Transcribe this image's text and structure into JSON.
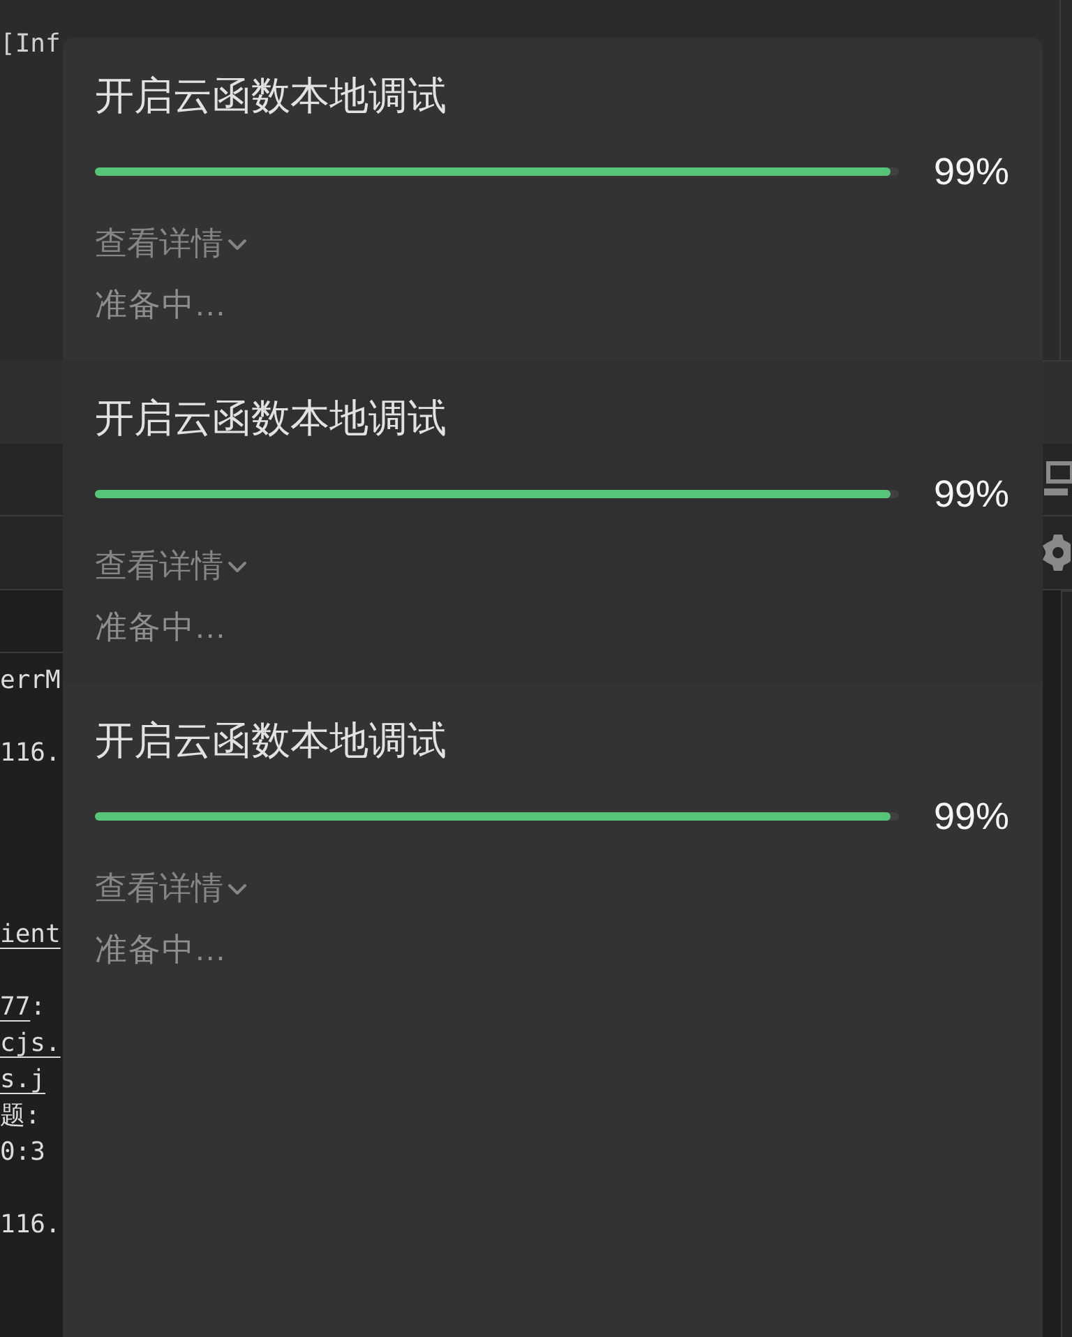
{
  "editor": {
    "code_line": "[Inf"
  },
  "console": {
    "lines": [
      {
        "segments": [
          {
            "text": "errM",
            "link": false
          }
        ]
      },
      {
        "segments": [
          {
            "text": "116.",
            "link": false
          }
        ]
      },
      {
        "segments": [
          {
            "text": "ient",
            "link": true
          }
        ]
      },
      {
        "segments": [
          {
            "text": "77",
            "link": true
          },
          {
            "text": ":",
            "link": false
          }
        ]
      },
      {
        "segments": [
          {
            "text": "cjs.",
            "link": true
          }
        ]
      },
      {
        "segments": [
          {
            "text": "s.j",
            "link": true
          }
        ]
      },
      {
        "segments": [
          {
            "text": "题:",
            "link": false
          }
        ]
      },
      {
        "segments": [
          {
            "text": "0:3",
            "link": false
          }
        ]
      },
      {
        "segments": [
          {
            "text": "116.",
            "link": false
          }
        ]
      }
    ]
  },
  "tasks": [
    {
      "title": "开启云函数本地调试",
      "level": 0.99,
      "percent": "99%",
      "details_link": "查看详情",
      "status": "准备中..."
    },
    {
      "title": "开启云函数本地调试",
      "level": 0.99,
      "percent": "99%",
      "details_link": "查看详情",
      "status": "准备中..."
    },
    {
      "title": "开启云函数本地调试",
      "level": 0.99,
      "percent": "99%",
      "details_link": "查看详情",
      "status": "准备中..."
    }
  ]
}
